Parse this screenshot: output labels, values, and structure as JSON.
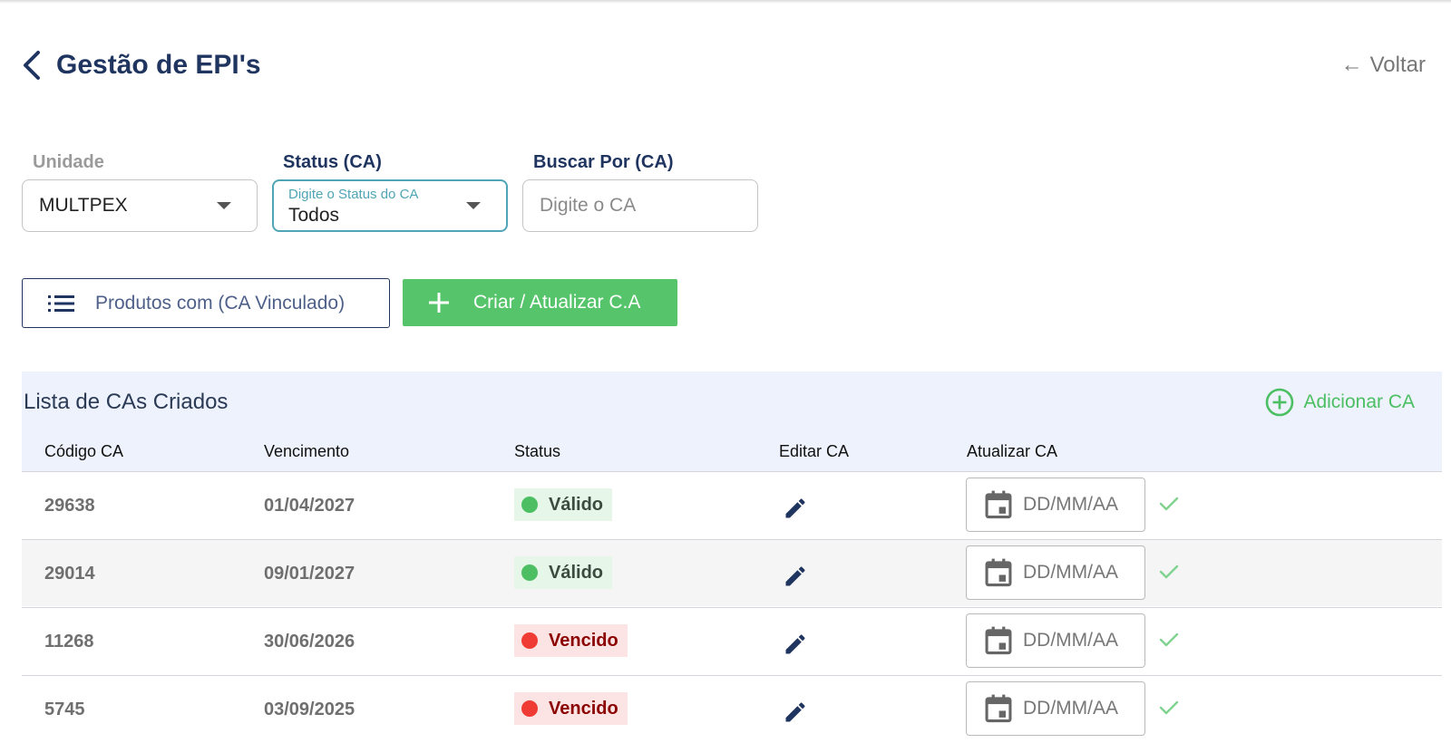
{
  "header": {
    "title": "Gestão de EPI's",
    "back_label": "Voltar",
    "back_arrow": "←"
  },
  "filters": {
    "unidade": {
      "label": "Unidade",
      "value": "MULTPEX"
    },
    "status": {
      "label": "Status (CA)",
      "floating_label": "Digite o Status do CA",
      "value": "Todos"
    },
    "buscar": {
      "label": "Buscar Por (CA)",
      "placeholder": "Digite o CA"
    }
  },
  "actions": {
    "products_button": "Produtos com (CA Vinculado)",
    "create_button": "Criar / Atualizar C.A"
  },
  "list": {
    "title": "Lista de CAs Criados",
    "add_label": "Adicionar CA",
    "columns": [
      "Código CA",
      "Vencimento",
      "Status",
      "Editar CA",
      "Atualizar CA"
    ],
    "date_placeholder": "DD/MM/AA",
    "rows": [
      {
        "codigo": "29638",
        "vencimento": "01/04/2027",
        "status": "Válido"
      },
      {
        "codigo": "29014",
        "vencimento": "09/01/2027",
        "status": "Válido"
      },
      {
        "codigo": "11268",
        "vencimento": "30/06/2026",
        "status": "Vencido"
      },
      {
        "codigo": "5745",
        "vencimento": "03/09/2025",
        "status": "Vencido"
      }
    ]
  },
  "colors": {
    "primary": "#1f3560",
    "accent_green": "#55c46a",
    "focus_teal": "#4fa4b6",
    "valid_bg": "#e6f6e9",
    "valid_dot": "#4cbf63",
    "valid_text": "#3c4a3f",
    "expired_bg": "#fde4e4",
    "expired_dot": "#ef3b33",
    "expired_text": "#8b0000",
    "panel_bg": "#edf2fc"
  },
  "icons": {
    "back": "chevron-left-icon",
    "list": "list-icon",
    "plus": "plus-icon",
    "add_circle": "plus-circle-icon",
    "edit": "pencil-icon",
    "calendar": "calendar-icon",
    "check": "check-icon",
    "dropdown": "caret-down-icon"
  }
}
